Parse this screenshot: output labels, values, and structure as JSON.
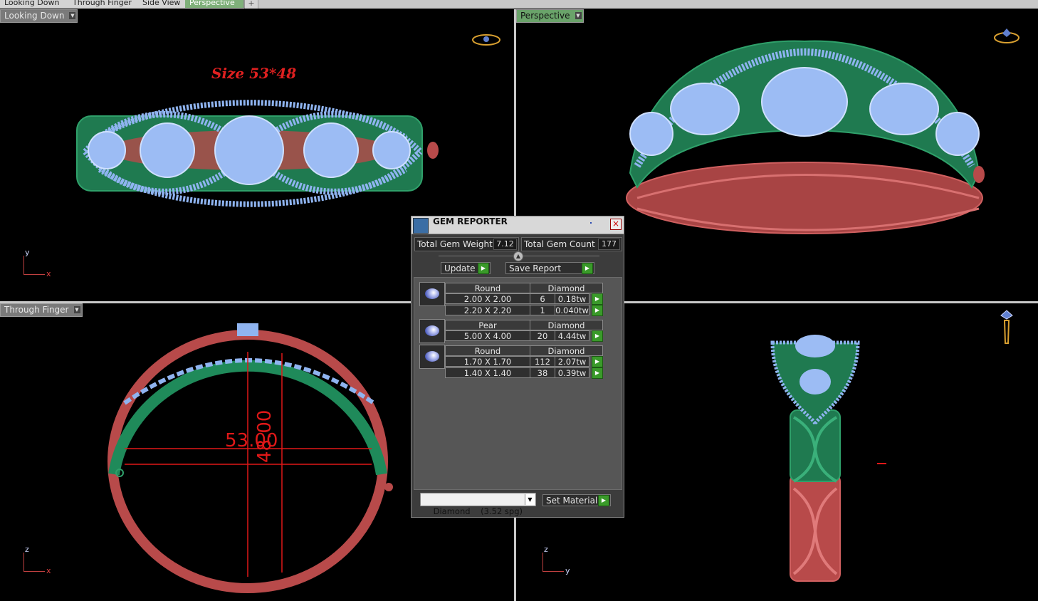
{
  "tabs": [
    {
      "label": "Looking Down",
      "active": false
    },
    {
      "label": "Through Finger",
      "active": false
    },
    {
      "label": "Side View",
      "active": false
    },
    {
      "label": "Perspective",
      "active": true
    }
  ],
  "tab_add_icon": "plus-icon",
  "viewports": {
    "top_left": {
      "label": "Looking Down",
      "annotation": "Size 53*48",
      "axes": {
        "v": "y",
        "h": "x"
      }
    },
    "top_right": {
      "label": "Perspective"
    },
    "bottom_left": {
      "label": "Through Finger",
      "dim_width": "53.00",
      "dim_height": "48.00",
      "axes": {
        "v": "z",
        "h": "x"
      }
    },
    "bottom_right": {
      "axes": {
        "v": "z",
        "h": "y"
      }
    }
  },
  "gem_reporter": {
    "title": "GEM REPORTER",
    "total_weight_label": "Total Gem Weight",
    "total_weight_value": "7.12",
    "total_count_label": "Total Gem Count",
    "total_count_value": "177",
    "update_label": "Update",
    "save_report_label": "Save Report",
    "groups": [
      {
        "shape": "Round",
        "material": "Diamond",
        "rows": [
          {
            "size": "2.00 X 2.00",
            "count": "6",
            "weight": "0.18tw"
          },
          {
            "size": "2.20 X 2.20",
            "count": "1",
            "weight": "0.040tw"
          }
        ]
      },
      {
        "shape": "Pear",
        "material": "Diamond",
        "rows": [
          {
            "size": "5.00 X 4.00",
            "count": "20",
            "weight": "4.44tw"
          }
        ]
      },
      {
        "shape": "Round",
        "material": "Diamond",
        "rows": [
          {
            "size": "1.70 X 1.70",
            "count": "112",
            "weight": "2.07tw"
          },
          {
            "size": "1.40 X 1.40",
            "count": "38",
            "weight": "0.39tw"
          }
        ]
      }
    ],
    "material_select": "Diamond    (3.52 spg)",
    "set_material_label": "Set Material"
  },
  "colors": {
    "metal_green": "#1f8a5a",
    "metal_red": "#b84a4a",
    "gems": "#8fb4f0",
    "dim_red": "#e01818",
    "accent_green": "#3a9a2a"
  }
}
